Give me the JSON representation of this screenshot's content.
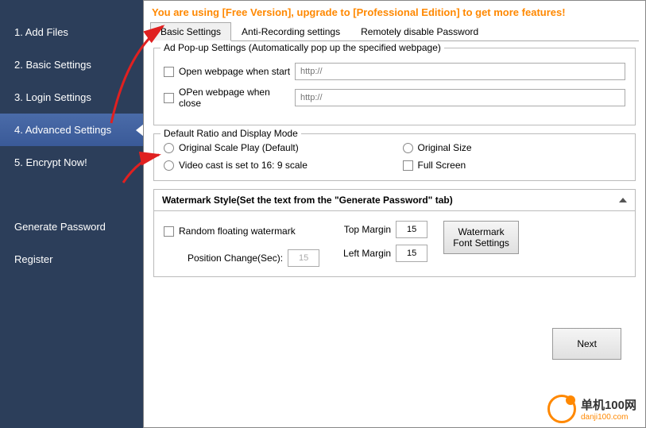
{
  "sidebar": {
    "items": [
      {
        "label": "1. Add Files"
      },
      {
        "label": "2. Basic Settings"
      },
      {
        "label": "3. Login Settings"
      },
      {
        "label": "4. Advanced Settings"
      },
      {
        "label": "5. Encrypt Now!"
      }
    ],
    "extra": [
      {
        "label": "Generate Password"
      },
      {
        "label": "Register"
      }
    ]
  },
  "banner": "You are using [Free Version], upgrade to [Professional Edition] to get more features!",
  "tabs": [
    {
      "label": "Basic Settings"
    },
    {
      "label": "Anti-Recording settings"
    },
    {
      "label": "Remotely disable Password"
    }
  ],
  "popup": {
    "title": "Ad Pop-up Settings (Automatically pop up the specified webpage)",
    "start_label": "Open webpage when start",
    "close_label": "OPen webpage when close",
    "placeholder": "http://"
  },
  "ratio": {
    "title": "Default Ratio and Display Mode",
    "opt1": "Original Scale Play (Default)",
    "opt2": "Original Size",
    "opt3": "Video cast is set to 16: 9 scale",
    "opt4": "Full Screen"
  },
  "watermark": {
    "title": "Watermark Style(Set the text from the \"Generate Password\" tab)",
    "random_label": "Random floating watermark",
    "pos_label": "Position Change(Sec):",
    "pos_value": "15",
    "top_label": "Top Margin",
    "top_value": "15",
    "left_label": "Left Margin",
    "left_value": "15",
    "font_btn": "Watermark Font Settings"
  },
  "next_button": "Next",
  "logo": {
    "name": "单机100网",
    "url": "danji100.com"
  }
}
